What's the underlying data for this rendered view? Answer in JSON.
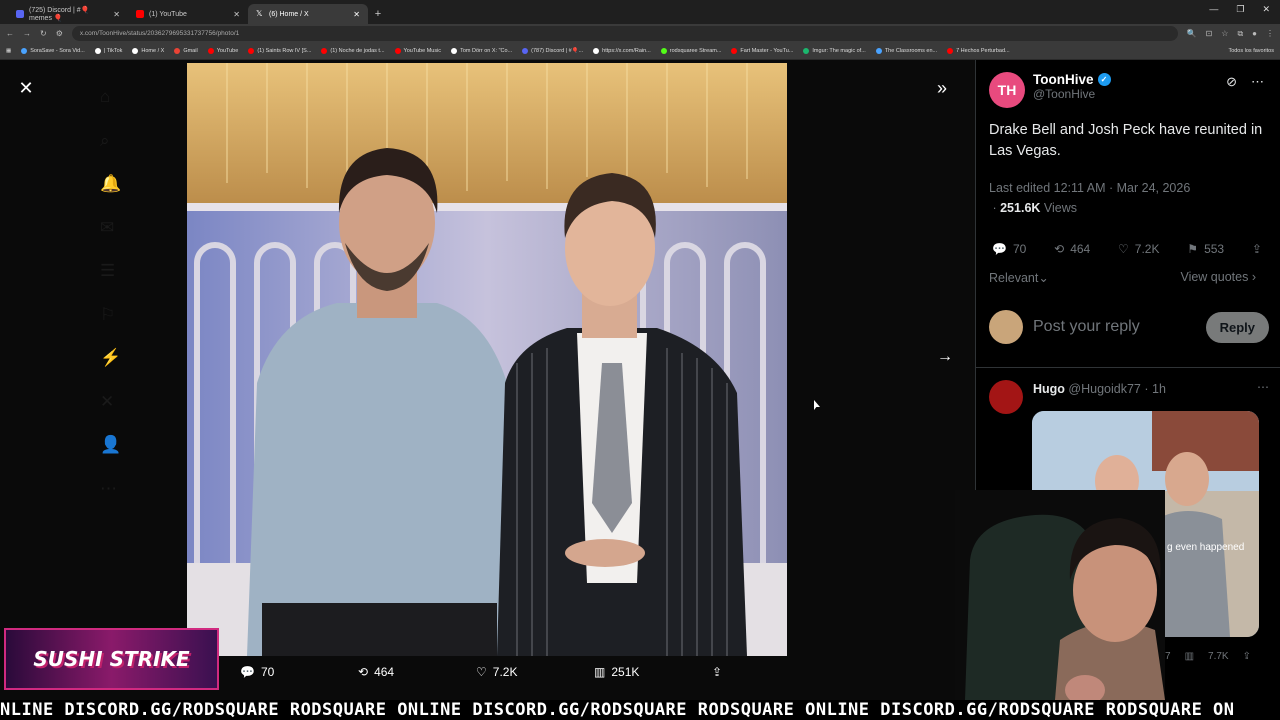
{
  "browser": {
    "tabs": [
      {
        "label": "(725) Discord | #🎈memes 🎈",
        "color": "#5865f2",
        "active": false
      },
      {
        "label": "(1) YouTube",
        "color": "#ff0000",
        "active": false
      },
      {
        "label": "(6) Home / X",
        "color": "#ffffff",
        "active": true
      }
    ],
    "new_tab": "+",
    "url": "x.com/ToonHive/status/2036279695331737756/photo/1",
    "bookmarks": [
      {
        "label": "SoraSave - Sora Vid...",
        "color": "#4aa3ff"
      },
      {
        "label": "| TikTok",
        "color": "#ffffff"
      },
      {
        "label": "Home / X",
        "color": "#ffffff"
      },
      {
        "label": "Gmail",
        "color": "#ea4335"
      },
      {
        "label": "YouTube",
        "color": "#ff0000"
      },
      {
        "label": "(1) Saints Row IV [S...",
        "color": "#ff0000"
      },
      {
        "label": "(1) Noche de jodas t...",
        "color": "#ff0000"
      },
      {
        "label": "YouTube Music",
        "color": "#ff0000"
      },
      {
        "label": "Tom Dörr on X: \"Co...",
        "color": "#ffffff"
      },
      {
        "label": "(787) Discord | #🎈...",
        "color": "#5865f2"
      },
      {
        "label": "https://x.com/Rain...",
        "color": "#ffffff"
      },
      {
        "label": "rodsquaree Stream...",
        "color": "#53fc18"
      },
      {
        "label": "Fart Master - YouTu...",
        "color": "#ff0000"
      },
      {
        "label": "Imgur: The magic of...",
        "color": "#1bb76e"
      },
      {
        "label": "The Classrooms en...",
        "color": "#4aa3ff"
      },
      {
        "label": "7 Hechos Perturbad...",
        "color": "#ff0000"
      }
    ],
    "all_favorites": "Todos los favoritos"
  },
  "viewer": {
    "bottom_stats": [
      {
        "icon": "comment-icon",
        "glyph": "💬",
        "value": "70"
      },
      {
        "icon": "retweet-icon",
        "glyph": "⟲",
        "value": "464"
      },
      {
        "icon": "like-icon",
        "glyph": "♡",
        "value": "7.2K"
      },
      {
        "icon": "views-icon",
        "glyph": "▥",
        "value": "251K"
      },
      {
        "icon": "share-icon",
        "glyph": "⇪",
        "value": ""
      }
    ]
  },
  "post": {
    "avatar_initials": "TH",
    "name": "ToonHive",
    "handle": "@ToonHive",
    "text": "Drake Bell and Josh Peck have reunited in Las Vegas.",
    "edited": "Last edited 12:11 AM · Mar 24, 2026",
    "views_count": "251.6K",
    "views_label": " Views",
    "actions": [
      {
        "icon": "reply-icon",
        "glyph": "💬",
        "value": "70"
      },
      {
        "icon": "retweet-icon",
        "glyph": "⟲",
        "value": "464"
      },
      {
        "icon": "like-icon",
        "glyph": "♡",
        "value": "7.2K"
      },
      {
        "icon": "bookmark-icon",
        "glyph": "⚑",
        "value": "553"
      },
      {
        "icon": "share-icon",
        "glyph": "⇪",
        "value": ""
      }
    ],
    "sort": "Relevant",
    "view_quotes": "View quotes",
    "reply_placeholder": "Post your reply",
    "reply_button": "Reply"
  },
  "reply": {
    "name": "Hugo",
    "handle": "@Hugoidk77",
    "time": " · 1h",
    "image_caption": "g even happened",
    "stats": [
      "7",
      "7.7K"
    ]
  },
  "stream": {
    "logo_text": "SUSHI STRIKE",
    "ticker": "NLINE DISCORD.GG/RODSQUARE RODSQUARE ONLINE DISCORD.GG/RODSQUARE RODSQUARE ONLINE DISCORD.GG/RODSQUARE RODSQUARE ON"
  }
}
